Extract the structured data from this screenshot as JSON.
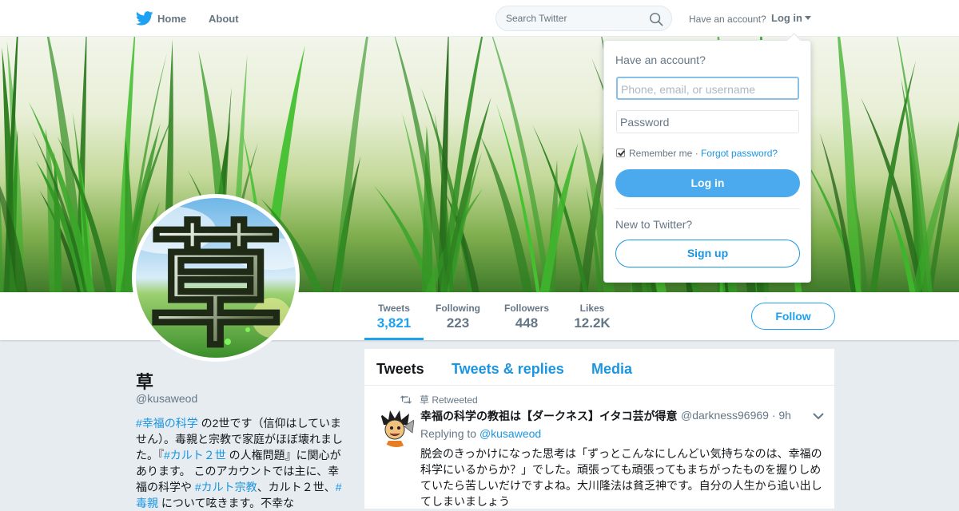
{
  "nav": {
    "home_label": "Home",
    "about_label": "About",
    "search_placeholder": "Search Twitter",
    "have_account_label": "Have an account?",
    "login_label": "Log in"
  },
  "profile": {
    "name": "草",
    "handle": "@kusaweod",
    "avatar_glyph": "草",
    "bio": [
      {
        "type": "link",
        "text": "#幸福の科学"
      },
      {
        "type": "text",
        "text": " の2世です（信仰はしていません）。毒親と宗教で家庭がほぼ壊れました。『"
      },
      {
        "type": "link",
        "text": "#カルト２世"
      },
      {
        "type": "text",
        "text": " の人権問題』に関心があります。 このアカウントでは主に、幸福の科学や "
      },
      {
        "type": "link",
        "text": "#カルト宗教"
      },
      {
        "type": "text",
        "text": "、カルト２世、"
      },
      {
        "type": "link",
        "text": "#毒親"
      },
      {
        "type": "text",
        "text": " について呟きます。不幸な"
      }
    ],
    "follow_label": "Follow"
  },
  "stats": [
    {
      "label": "Tweets",
      "value": "3,821",
      "active": true
    },
    {
      "label": "Following",
      "value": "223",
      "active": false
    },
    {
      "label": "Followers",
      "value": "448",
      "active": false
    },
    {
      "label": "Likes",
      "value": "12.2K",
      "active": false
    }
  ],
  "timeline": {
    "tabs": [
      {
        "label": "Tweets",
        "active": true
      },
      {
        "label": "Tweets & replies",
        "active": false
      },
      {
        "label": "Media",
        "active": false
      }
    ],
    "tweet": {
      "retweet_label": "草 Retweeted",
      "author_name": "幸福の科学の教祖は【ダークネス】イタコ芸が得意",
      "author_meta": "@darkness96969 · 9h",
      "replying_prefix": "Replying to",
      "replying_handle": "@kusaweod",
      "text": "脱会のきっかけになった思考は「ずっとこんなにしんどい気持ちなのは、幸福の科学にいるからか？」でした。頑張っても頑張ってもまちがったものを握りしめていたら苦しいだけですよね。大川隆法は貧乏神です。自分の人生から追い出してしまいましょう"
    }
  },
  "login_dropdown": {
    "title": "Have an account?",
    "username_placeholder": "Phone, email, or username",
    "password_placeholder": "Password",
    "remember_label": "Remember me",
    "separator": " · ",
    "forgot_label": "Forgot password?",
    "remember_checked": true,
    "login_button": "Log in",
    "new_label": "New to Twitter?",
    "signup_button": "Sign up"
  },
  "colors": {
    "accent": "#1da1f2",
    "link": "#1b95e0",
    "background": "#e6ecf0"
  }
}
